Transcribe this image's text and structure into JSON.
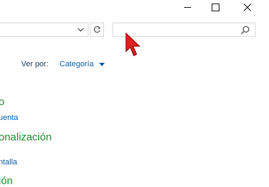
{
  "titlebar": {
    "minimize_icon": "minimize-icon",
    "maximize_icon": "maximize-icon",
    "close_icon": "close-icon"
  },
  "address_bar": {
    "value": "",
    "dropdown_icon": "chevron-down-icon",
    "refresh_icon": "refresh-icon"
  },
  "search": {
    "value": "",
    "placeholder": "",
    "icon": "search-icon"
  },
  "view_by": {
    "label": "Ver por:",
    "value": "Categoría",
    "icon": "caret-down-icon"
  },
  "categories": [
    {
      "title": "o",
      "link": "uenta"
    },
    {
      "title": "onalización",
      "link": "ntalla"
    },
    {
      "title": "ión"
    }
  ],
  "colors": {
    "category_title": "#1f8a2e",
    "link": "#0b5ea8",
    "cursor": "#e02020"
  }
}
